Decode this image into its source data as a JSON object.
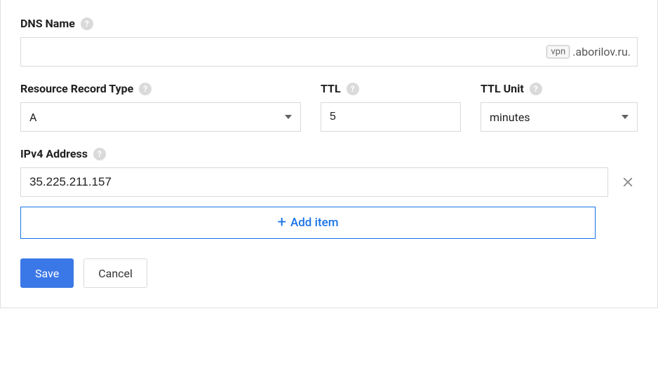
{
  "dns_name": {
    "label": "DNS Name",
    "value": "",
    "prefix_badge": "vpn",
    "suffix": ".aborilov.ru."
  },
  "record_type": {
    "label": "Resource Record Type",
    "value": "A"
  },
  "ttl": {
    "label": "TTL",
    "value": "5"
  },
  "ttl_unit": {
    "label": "TTL Unit",
    "value": "minutes"
  },
  "ipv4": {
    "label": "IPv4 Address",
    "entries": [
      {
        "value": "35.225.211.157"
      }
    ]
  },
  "add_item_label": "Add item",
  "buttons": {
    "save": "Save",
    "cancel": "Cancel"
  }
}
